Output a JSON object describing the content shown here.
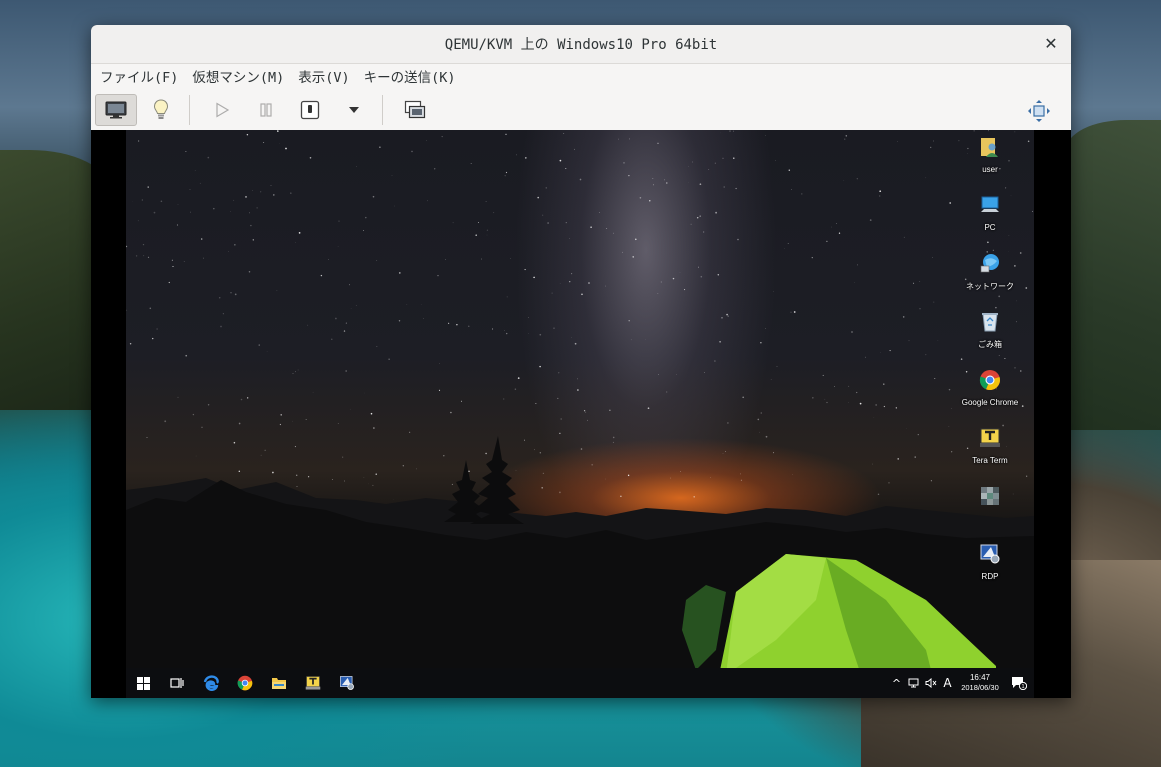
{
  "window": {
    "title": "QEMU/KVM 上の Windows10 Pro 64bit",
    "close_glyph": "✕"
  },
  "menu": [
    {
      "label": "ファイル(F)"
    },
    {
      "label": "仮想マシン(M)"
    },
    {
      "label": "表示(V)"
    },
    {
      "label": "キーの送信(K)"
    }
  ],
  "toolbar": {
    "icons": [
      "monitor-icon",
      "lightbulb-icon",
      "play-icon",
      "pause-icon",
      "power-icon",
      "chevron-down-icon",
      "snapshot-icon",
      "fullscreen-icon"
    ]
  },
  "desktop": {
    "icons": [
      {
        "label": "user",
        "icon": "user-folder-icon"
      },
      {
        "label": "PC",
        "icon": "pc-icon"
      },
      {
        "label": "ネットワーク",
        "icon": "network-icon"
      },
      {
        "label": "ごみ箱",
        "icon": "recycle-bin-icon"
      },
      {
        "label": "Google Chrome",
        "icon": "chrome-icon"
      },
      {
        "label": "Tera Term",
        "icon": "teraterm-icon"
      },
      {
        "label": "",
        "icon": "pixelated-icon"
      },
      {
        "label": "RDP",
        "icon": "rdp-icon"
      }
    ]
  },
  "taskbar": {
    "pinned": [
      "windows-start-icon",
      "task-view-icon",
      "edge-icon",
      "chrome-icon",
      "file-explorer-icon",
      "teraterm-icon",
      "rdp-icon"
    ],
    "tray": {
      "chevron": "^",
      "ime": "A",
      "time": "16:47",
      "date": "2018/06/30",
      "notification_count": "1"
    }
  }
}
